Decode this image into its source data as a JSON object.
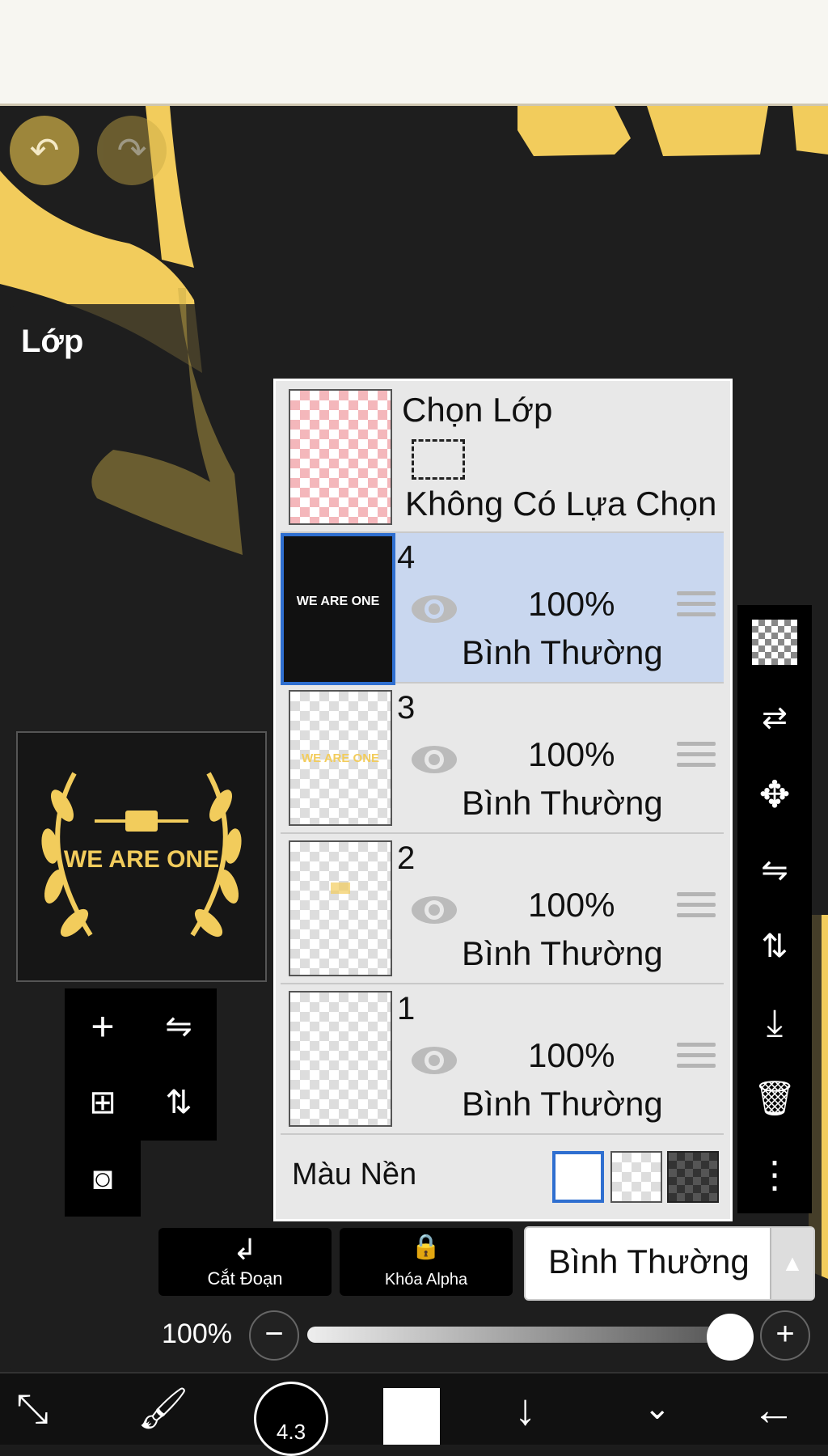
{
  "panel_title": "Lớp",
  "select_layer": {
    "title": "Chọn Lớp",
    "subtitle": "Không Có Lựa Chọn"
  },
  "layers": [
    {
      "number": "4",
      "opacity": "100%",
      "blend": "Bình Thường",
      "selected": true
    },
    {
      "number": "3",
      "opacity": "100%",
      "blend": "Bình Thường",
      "selected": false
    },
    {
      "number": "2",
      "opacity": "100%",
      "blend": "Bình Thường",
      "selected": false
    },
    {
      "number": "1",
      "opacity": "100%",
      "blend": "Bình Thường",
      "selected": false
    }
  ],
  "background_label": "Màu Nền",
  "preview_text": "WE ARE ONE",
  "buttons": {
    "clipping": "Cắt Đoạn",
    "alpha_lock": "Khóa Alpha",
    "blend_mode": "Bình Thường"
  },
  "opacity_value": "100%",
  "brush_size": "4.3",
  "colors": {
    "accent_yellow": "#f2cc5c",
    "selected_row": "#c9d7ef",
    "selected_border": "#2f6fd0"
  }
}
